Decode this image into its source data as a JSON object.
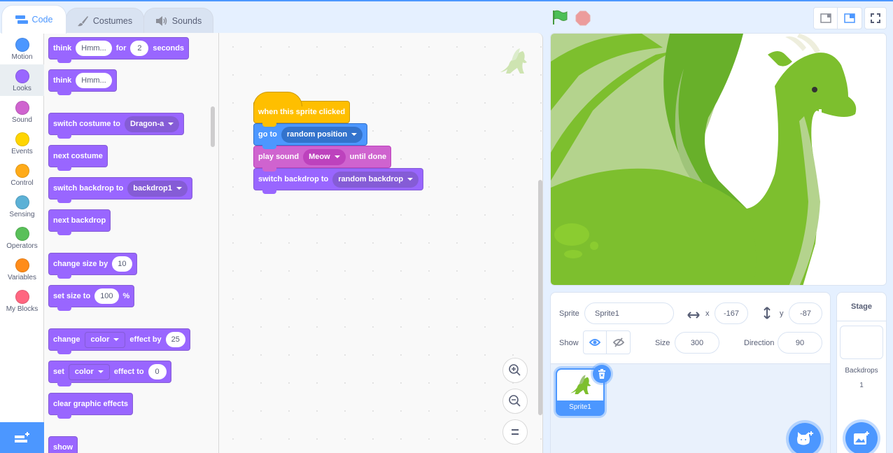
{
  "tabs": [
    {
      "label": "Code",
      "icon": "code-icon",
      "active": true
    },
    {
      "label": "Costumes",
      "icon": "brush-icon",
      "active": false
    },
    {
      "label": "Sounds",
      "icon": "speaker-icon",
      "active": false
    }
  ],
  "categories": [
    {
      "label": "Motion",
      "color": "#4c97ff"
    },
    {
      "label": "Looks",
      "color": "#9966ff",
      "active": true
    },
    {
      "label": "Sound",
      "color": "#cf63cf"
    },
    {
      "label": "Events",
      "color": "#ffd500"
    },
    {
      "label": "Control",
      "color": "#ffab19"
    },
    {
      "label": "Sensing",
      "color": "#5cb1d6"
    },
    {
      "label": "Operators",
      "color": "#59c059"
    },
    {
      "label": "Variables",
      "color": "#ff8c1a"
    },
    {
      "label": "My Blocks",
      "color": "#ff6680"
    }
  ],
  "palette": {
    "think_for": {
      "t1": "think",
      "msg": "Hmm...",
      "t2": "for",
      "secs": "2",
      "t3": "seconds"
    },
    "think": {
      "t1": "think",
      "msg": "Hmm..."
    },
    "switch_costume": {
      "t1": "switch costume to",
      "value": "Dragon-a"
    },
    "next_costume": {
      "t1": "next costume"
    },
    "switch_backdrop": {
      "t1": "switch backdrop to",
      "value": "backdrop1"
    },
    "next_backdrop": {
      "t1": "next backdrop"
    },
    "change_size": {
      "t1": "change size by",
      "value": "10"
    },
    "set_size": {
      "t1": "set size to",
      "value": "100",
      "t2": "%"
    },
    "change_effect": {
      "t1": "change",
      "effect": "color",
      "t2": "effect by",
      "value": "25"
    },
    "set_effect": {
      "t1": "set",
      "effect": "color",
      "t2": "effect to",
      "value": "0"
    },
    "clear_effects": {
      "t1": "clear graphic effects"
    },
    "show": {
      "t1": "show"
    }
  },
  "script": {
    "hat": "when this sprite clicked",
    "goto": {
      "t1": "go to",
      "value": "random position"
    },
    "play_sound": {
      "t1": "play sound",
      "value": "Meow",
      "t2": "until done"
    },
    "switch_backdrop": {
      "t1": "switch backdrop to",
      "value": "random backdrop"
    }
  },
  "sprite_info": {
    "sprite_label": "Sprite",
    "sprite_name": "Sprite1",
    "x_label": "x",
    "x": "-167",
    "y_label": "y",
    "y": "-87",
    "show_label": "Show",
    "size_label": "Size",
    "size": "300",
    "direction_label": "Direction",
    "direction": "90"
  },
  "sprites": [
    {
      "name": "Sprite1",
      "selected": true
    }
  ],
  "stage_panel": {
    "title": "Stage",
    "backdrops_label": "Backdrops",
    "backdrops_count": "1"
  }
}
